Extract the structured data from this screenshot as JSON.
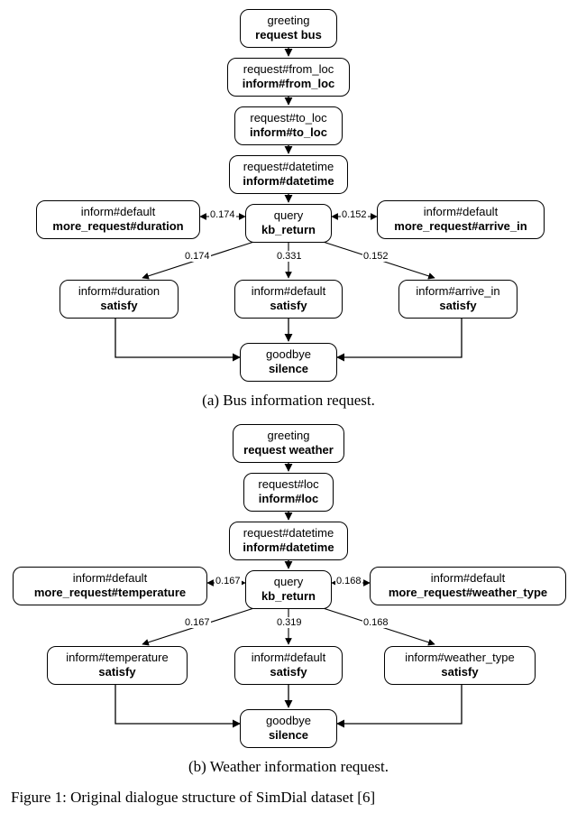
{
  "bus": {
    "caption": "(a) Bus information request.",
    "nodes": {
      "n1": {
        "l1": "greeting",
        "l2": "request bus"
      },
      "n2": {
        "l1": "request#from_loc",
        "l2": "inform#from_loc"
      },
      "n3": {
        "l1": "request#to_loc",
        "l2": "inform#to_loc"
      },
      "n4": {
        "l1": "request#datetime",
        "l2": "inform#datetime"
      },
      "n5": {
        "l1": "query",
        "l2": "kb_return"
      },
      "n5L": {
        "l1": "inform#default",
        "l2": "more_request#duration"
      },
      "n5R": {
        "l1": "inform#default",
        "l2": "more_request#arrive_in"
      },
      "n6L": {
        "l1": "inform#duration",
        "l2": "satisfy"
      },
      "n6M": {
        "l1": "inform#default",
        "l2": "satisfy"
      },
      "n6R": {
        "l1": "inform#arrive_in",
        "l2": "satisfy"
      },
      "n7": {
        "l1": "goodbye",
        "l2": "silence"
      }
    },
    "edge_labels": {
      "e5_5L": "0.174",
      "e5_5R": "0.152",
      "e5_6L": "0.174",
      "e5_6M": "0.331",
      "e5_6R": "0.152"
    }
  },
  "weather": {
    "caption": "(b) Weather information request.",
    "nodes": {
      "n1": {
        "l1": "greeting",
        "l2": "request weather"
      },
      "n2": {
        "l1": "request#loc",
        "l2": "inform#loc"
      },
      "n3": {
        "l1": "request#datetime",
        "l2": "inform#datetime"
      },
      "n4": {
        "l1": "query",
        "l2": "kb_return"
      },
      "n4L": {
        "l1": "inform#default",
        "l2": "more_request#temperature"
      },
      "n4R": {
        "l1": "inform#default",
        "l2": "more_request#weather_type"
      },
      "n5L": {
        "l1": "inform#temperature",
        "l2": "satisfy"
      },
      "n5M": {
        "l1": "inform#default",
        "l2": "satisfy"
      },
      "n5R": {
        "l1": "inform#weather_type",
        "l2": "satisfy"
      },
      "n6": {
        "l1": "goodbye",
        "l2": "silence"
      }
    },
    "edge_labels": {
      "e4_4L": "0.167",
      "e4_4R": "0.168",
      "e4_5L": "0.167",
      "e4_5M": "0.319",
      "e4_5R": "0.168"
    }
  },
  "footer_text": "Figure 1: Original dialogue structure of SimDial dataset [6]"
}
